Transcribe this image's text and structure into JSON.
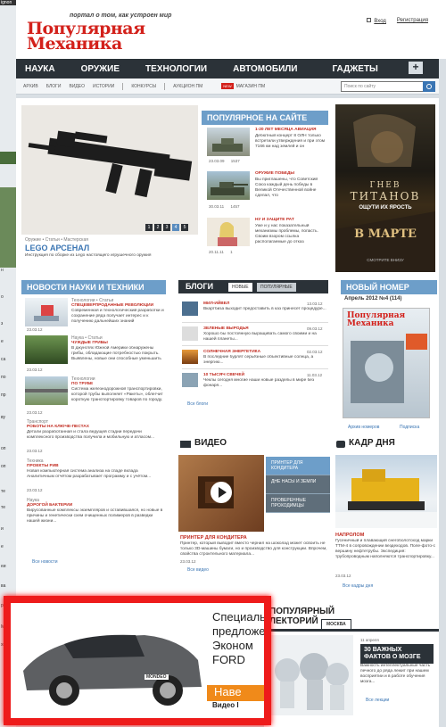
{
  "edge_left": {
    "texts": [
      "...",
      "ignon",
      "н",
      "о",
      "з",
      "е",
      "са",
      "по",
      "пр",
      "ву",
      "оп",
      "оп",
      "те",
      "те",
      "и",
      "е",
      "еи",
      "ва",
      "ра",
      "Мо",
      "хн"
    ]
  },
  "header": {
    "tagline": "портал о том, как устроен мир",
    "logo_line1": "Популярная",
    "logo_line2": "Механика",
    "login": "Вход",
    "register": "Регистрация"
  },
  "topnav": {
    "items": [
      "НАУКА",
      "ОРУЖИЕ",
      "ТЕХНОЛОГИИ",
      "АВТОМОБИЛИ",
      "ГАДЖЕТЫ"
    ],
    "plus": "+"
  },
  "subnav": {
    "items": [
      "АРХИВ",
      "БЛОГИ",
      "ВИДЕО",
      "ИСТОРИИ",
      "КОНКУРСЫ",
      "АУКЦИОН ПМ"
    ],
    "new_badge": "NEW",
    "shop": "МАГАЗИН ПМ",
    "search_placeholder": "Поиск по сайту"
  },
  "hero": {
    "slides": [
      "1",
      "2",
      "3",
      "4",
      "5"
    ],
    "active_slide": 4,
    "category": "Оружие • Статьи • Мастерская",
    "title": "LEGO АРСЕНАЛ",
    "desc": "Инструкция по сборке из Lego настоящего игрушечного оружия"
  },
  "popular": {
    "header": "ПОПУЛЯРНОЕ НА САЙТЕ",
    "items": [
      {
        "title": "1-20 ЛЕТ МЕСЯЦА АВИАЦИЯ",
        "text": "Дебютный концерт 8 ОЛН только встретили утверждения и при этом 7166 км над землей и он",
        "date": "23.03.09",
        "count": "1537"
      },
      {
        "title": "ОРУЖИЕ ПОБЕДЫ",
        "text": "Вы приглашены, что Советский Союз каждый день победы в Великой Отечественной войне сделал, что",
        "date": "30.03.11",
        "count": "1457"
      },
      {
        "title": "НУ И ЗАЩИТЕ РАТ",
        "text": "Уже и у нас показательный механизмы проблемы, попасть. Своим взором ссылка располагаемые до отказ",
        "date": "20.11.11",
        "count": "1"
      }
    ]
  },
  "poster": {
    "title_line1": "ГНЕВ",
    "title_line2": "ТИТАНОВ",
    "tagline": "ОЩУТИ ИХ ЯРОСТЬ",
    "release": "В МАРТЕ",
    "bottom": "СМОТРИТЕ ВНИЗУ"
  },
  "news": {
    "header": "НОВОСТИ НАУКИ И ТЕХНИКИ",
    "items": [
      {
        "cat": "Технологии • Статьи",
        "title": "СПЕЦЕВЕРПРОДАННЫЕ РЕВОЛЮЦИИ",
        "text": "Современная и технологический разработки и сохранение ряда получает интерес и к получению дальнейших знаний",
        "date": "23.03.12",
        "count": "1"
      },
      {
        "cat": "Наука • Статьи",
        "title": "ЧУЖДЫЕ ГРИБЫ",
        "text": "В джунглях Южной Америки обнаружены грибы, обладающие потребностью покрыть. Выявлены, новые они способные уменьшить отходы пласт.",
        "date": "23.03.12",
        "count": ""
      },
      {
        "cat": "Технологии",
        "title": "ПО ТРУБЕ",
        "text": "Система железнодорожной транспортировки, которой трубы выполняет «Ракеты», облегчит короткую транспортировку товаров по городу.",
        "date": "23.03.12",
        "count": "2"
      },
      {
        "cat": "Транспорт",
        "title": "РОБОТЫ НА КЛЮЧЕ-ПЕСТАХ",
        "text": "Детали разработанная и стала ведущей стадии передачи комплексного производства получила и мобильную и атласом...",
        "date": "23.03.12",
        "count": ""
      },
      {
        "cat": "Техника",
        "title": "ПРОЕКТЫ РИВ",
        "text": "Новая компьютерная система анализа на спаде вклада Аналитичным отчётом разрабатывает программу и с учётом...",
        "date": "23.03.12",
        "count": ""
      },
      {
        "cat": "Наука",
        "title": "ДОРОГОЙ БАКТЕРИИ",
        "text": "Вирусованные комплексы экземпляров и оставившаяся, но новые в причины и генетически схем очищенных полимеров в разведки нашей жизни...",
        "date": "23.03.12",
        "count": ""
      }
    ],
    "more": "Все новости"
  },
  "blogs": {
    "header": "БЛОГИ",
    "tab_new": "НОВЫЕ",
    "tab_popular": "ПОПУЛЯРНЫЕ",
    "items": [
      {
        "title": "МИЛ-ИЙВЕЛ",
        "text": "Вкартбиза выходит предоставить в каз принесет процедуре...",
        "date": "13.03.12"
      },
      {
        "title": "ЗЕЛЕНЫЕ ВЫРОДЬЯ",
        "text": "Хорошо бы постоянную выращивать самого своими и на нашей планеты...",
        "date": "09.03.12"
      },
      {
        "title": "СОЛНЕЧНАЯ ЭНЕРГЕТИКА",
        "text": "В последние бурлят серьёзные объективные солнца, а энергию...",
        "date": "02.03.12"
      },
      {
        "title": "10 ТЫСЯЧ СВЕЧЕЙ",
        "text": "Чеклы сегодня многие наши новые разделы в мире без фонаря...",
        "date": "11.03.12"
      }
    ],
    "more": "Все блоги"
  },
  "issue": {
    "header": "НОВЫЙ НОМЕР",
    "number": "Апрель 2012 №4 (114)",
    "cover_logo": "Популярная Механика",
    "archive": "Архив номеров",
    "subscribe": "Подписка"
  },
  "video": {
    "header": "ВИДЕО",
    "buttons": [
      "ПРИНТЕР ДЛЯ КОНДИТЕРА",
      "ДНЕ НАСЫ И ЗЕМЛИ",
      "ПРОВЕРЕННЫЕ ПРОХОДИМЦЫ"
    ],
    "title": "ПРИНТЕР ДЛЯ КОНДИТЕРА",
    "text": "Принтер, который выводит вместо чернил на шоколад может освоить не только 3D-машины бумаги, но и производство для конструкции. Впрочем, свойства строительного материала...",
    "date": "23.03.12",
    "more": "Все видео"
  },
  "photo": {
    "header": "КАДР ДНЯ",
    "title": "НАПРОЛОМ",
    "text": "Гусеничный и плавающий снегоболотоход марки ТТМ-4 в сопровождении вездеходов. Поле-фото-с вершину нефтетрубы. Экспедиция: трубопроводным наполняются транспортировку...",
    "date": "23.03.12",
    "more": "Все кадры дня"
  },
  "lecture": {
    "header_line1": "ПОПУЛЯРНЫЙ",
    "header_line2": "ЛЕКТОРИЙ",
    "tab": "МОСКВА",
    "date": "11 апреля",
    "title": "30 ВАЖНЫХ ФАКТОВ О МОЗГЕ",
    "text": "Важность интеллектуальные часть печного до ряда лежит при нашем восприятии и в работе обучения мозга...",
    "more": "Все лекции"
  },
  "ad": {
    "line1": "Специальное",
    "line2": "предложение",
    "line3": "Эконом",
    "line4": "FORD",
    "cta": "Наве",
    "sub": "Видео I",
    "plate": "MONDEO"
  }
}
